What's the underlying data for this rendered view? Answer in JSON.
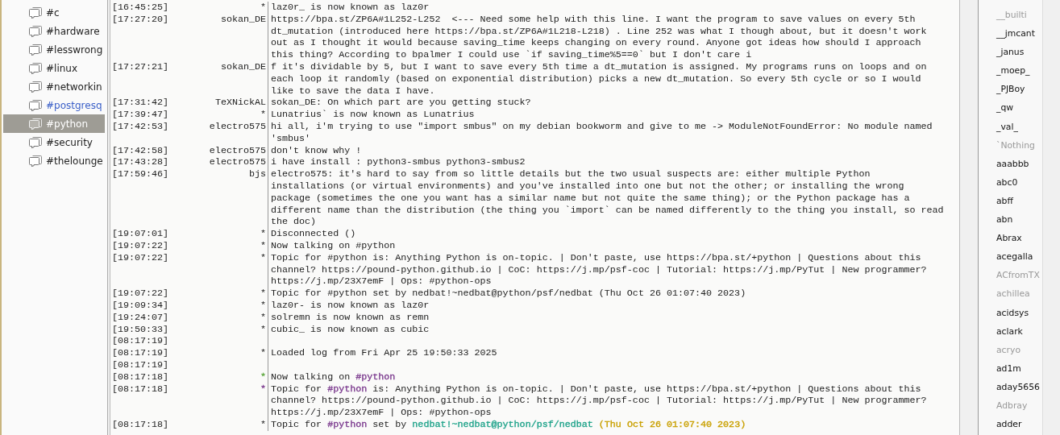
{
  "channels": [
    {
      "name": "#c",
      "selected": false,
      "highlighted": false
    },
    {
      "name": "#hardware",
      "selected": false,
      "highlighted": false
    },
    {
      "name": "#lesswrong",
      "selected": false,
      "highlighted": false
    },
    {
      "name": "#linux",
      "selected": false,
      "highlighted": false
    },
    {
      "name": "#networkin",
      "selected": false,
      "highlighted": false
    },
    {
      "name": "#postgresq",
      "selected": false,
      "highlighted": true
    },
    {
      "name": "#python",
      "selected": true,
      "highlighted": false
    },
    {
      "name": "#security",
      "selected": false,
      "highlighted": false
    },
    {
      "name": "#thelounge",
      "selected": false,
      "highlighted": false
    }
  ],
  "messages": [
    {
      "time": "[16:45:25]",
      "nick": "*",
      "text": "laz0r_ is now known as laz0r"
    },
    {
      "time": "[17:27:20]",
      "nick": "sokan_DE",
      "text": "https://bpa.st/ZP6A#1L252-L252  <--- Need some help with this line. I want the program to save values on every 5th dt_mutation (introduced here https://bpa.st/ZP6A#1L218-L218) . Line 252 was what I though about, but it doesn't work out as I thought it would because saving_time keeps changing on every round. Anyone got ideas how should I approach this thing? According to bpalmer I could use `if saving_time%5==0` but I don't care i"
    },
    {
      "time": "[17:27:21]",
      "nick": "sokan_DE",
      "text": "f it's dividable by 5, but I want to save every 5th time a dt_mutation is assigned. My programs runs on loops and on each loop it randomly (based on exponential distribution) picks a new dt_mutation. So every 5th cycle or so I would like to save the data I have."
    },
    {
      "time": "[17:31:42]",
      "nick": "TeXNickAL",
      "text": "sokan_DE: On which part are you getting stuck?"
    },
    {
      "time": "[17:39:47]",
      "nick": "*",
      "text": "Lunatrius` is now known as Lunatrius"
    },
    {
      "time": "[17:42:53]",
      "nick": "electro575",
      "text": "hi all, i'm trying to use \"import smbus\" on my debian bookworm and give to me -> ModuleNotFoundError: No module named 'smbus'"
    },
    {
      "time": "[17:42:58]",
      "nick": "electro575",
      "text": "don't know why !"
    },
    {
      "time": "[17:43:28]",
      "nick": "electro575",
      "text": "i have install : python3-smbus python3-smbus2"
    },
    {
      "time": "[17:59:46]",
      "nick": "bjs",
      "text": "electro575: it's hard to say from so little details but the two usual suspects are: either multiple Python installations (or virtual environments) and you've installed into one but not the other; or installing the wrong package (sometimes the one you want has a similar name but not quite the same thing); or the Python package has a different name than the distribution (the thing you `import` can be named differently to the thing you install, so read the doc)"
    },
    {
      "time": "[19:07:01]",
      "nick": "*",
      "text": "Disconnected ()"
    },
    {
      "time": "[19:07:22]",
      "nick": "*",
      "text": "Now talking on #python"
    },
    {
      "time": "[19:07:22]",
      "nick": "*",
      "text": "Topic for #python is: Anything Python is on-topic. | Don't paste, use https://bpa.st/+python | Questions about this channel? https://pound-python.github.io | CoC: https://j.mp/psf-coc | Tutorial: https://j.mp/PyTut | New programmer? https://j.mp/23X7emF | Ops: #python-ops"
    },
    {
      "time": "[19:07:22]",
      "nick": "*",
      "text": "Topic for #python set by nedbat!~nedbat@python/psf/nedbat (Thu Oct 26 01:07:40 2023)"
    },
    {
      "time": "[19:09:34]",
      "nick": "*",
      "text": "laz0r- is now known as laz0r"
    },
    {
      "time": "[19:24:07]",
      "nick": "*",
      "text": "solremn is now known as remn"
    },
    {
      "time": "[19:50:33]",
      "nick": "*",
      "text": "cubic_ is now known as cubic"
    },
    {
      "time": "[08:17:19]"
    },
    {
      "time": "[08:17:19]",
      "nick": "*",
      "text": "Loaded log from Fri Apr 25 19:50:33 2025"
    },
    {
      "time": "[08:17:19]"
    },
    {
      "time": "[08:17:18]",
      "nick": "*",
      "color": "#5aa63c",
      "parts": [
        {
          "text": "Now talking on "
        },
        {
          "text": "#python",
          "color": "#7b3a8e"
        }
      ]
    },
    {
      "time": "[08:17:18]",
      "nick": "*",
      "color": "#7b3a8e",
      "parts": [
        {
          "text": "Topic for "
        },
        {
          "text": "#python",
          "color": "#7b3a8e"
        },
        {
          "text": " is: Anything Python is on-topic. | Don't paste, use https://bpa.st/+python | Questions about this channel? https://pound-python.github.io | CoC: https://j.mp/psf-coc | Tutorial: https://j.mp/PyTut | New programmer? https://j.mp/23X7emF | Ops: #python-ops"
        }
      ]
    },
    {
      "time": "[08:17:18]",
      "nick": "*",
      "parts": [
        {
          "text": "Topic for "
        },
        {
          "text": "#python",
          "color": "#7b3a8e"
        },
        {
          "text": " set by "
        },
        {
          "text": "nedbat!~nedbat@python/psf/nedbat",
          "color": "#1fa38a"
        },
        {
          "text": " (Thu Oct 26 01:07:40 2023)",
          "color": "#c9a000"
        }
      ]
    }
  ],
  "users": [
    {
      "nick": "__builti",
      "away": true
    },
    {
      "nick": "__jmcant",
      "away": false
    },
    {
      "nick": "_janus",
      "away": false
    },
    {
      "nick": "_moep_",
      "away": false
    },
    {
      "nick": "_PJBoy",
      "away": false
    },
    {
      "nick": "_qw",
      "away": false
    },
    {
      "nick": "_val_",
      "away": false
    },
    {
      "nick": "`Nothing",
      "away": true
    },
    {
      "nick": "aaabbb",
      "away": false
    },
    {
      "nick": "abc0",
      "away": false
    },
    {
      "nick": "abff",
      "away": false
    },
    {
      "nick": "abn",
      "away": false
    },
    {
      "nick": "Abrax",
      "away": false
    },
    {
      "nick": "acegalla",
      "away": false
    },
    {
      "nick": "ACfromTX",
      "away": true
    },
    {
      "nick": "achillea",
      "away": true
    },
    {
      "nick": "acidsys",
      "away": false
    },
    {
      "nick": "aclark",
      "away": false
    },
    {
      "nick": "acryo",
      "away": true
    },
    {
      "nick": "ad1m",
      "away": false
    },
    {
      "nick": "aday5656",
      "away": false
    },
    {
      "nick": "Adbray",
      "away": true
    },
    {
      "nick": "adder",
      "away": false
    }
  ]
}
